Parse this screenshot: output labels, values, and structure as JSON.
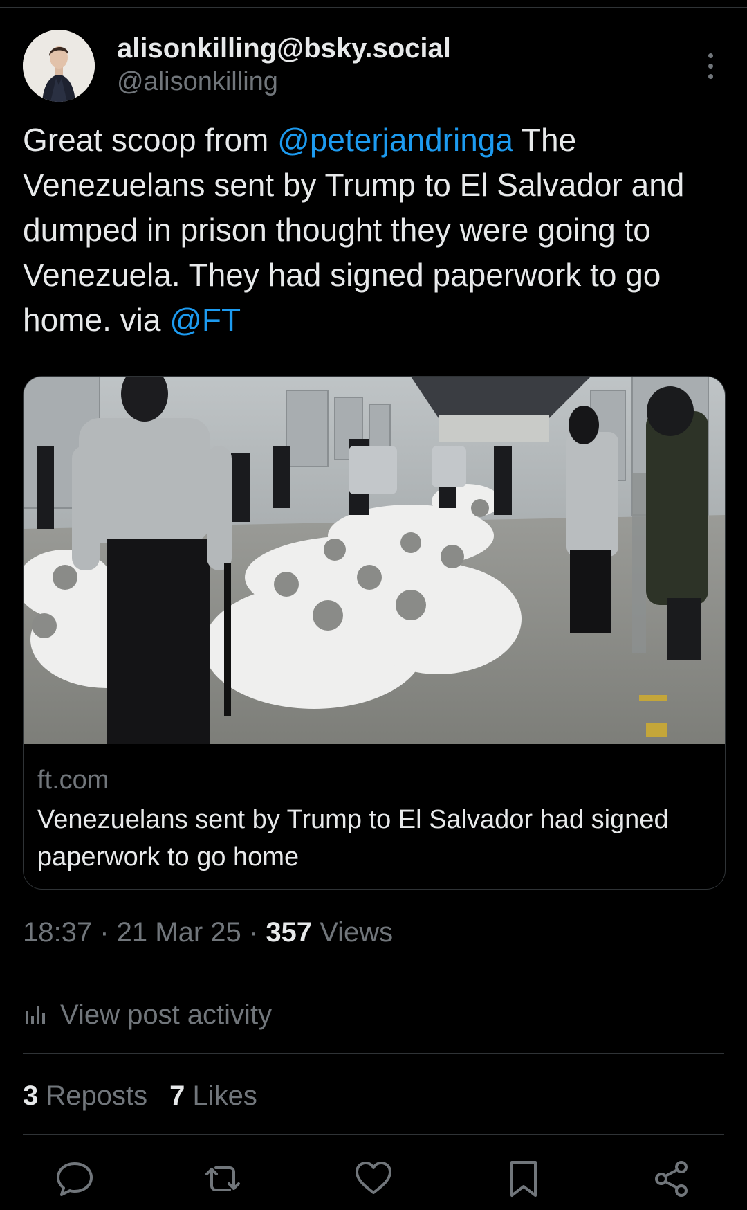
{
  "post": {
    "display_name": "alisonkilling@bsky.social",
    "handle": "@alisonkilling",
    "text": {
      "part1": "Great scoop from ",
      "mention1": "@peterjandringa",
      "part2": " The Venezuelans sent by Trump to El Salvador and dumped in prison thought they were going to Venezuela. They had signed paperwork to go home. via ",
      "mention2": "@FT"
    },
    "link_card": {
      "domain": "ft.com",
      "title": "Venezuelans sent by Trump to El Salvador had signed paperwork to go home"
    },
    "meta": {
      "time": "18:37",
      "date": "21 Mar 25",
      "views_count": "357",
      "views_label": "Views"
    },
    "activity_label": "View post activity",
    "reposts_count": "3",
    "reposts_label": "Reposts",
    "likes_count": "7",
    "likes_label": "Likes"
  },
  "icons": {
    "more": "more-vertical-icon",
    "activity": "bar-chart-icon",
    "reply": "reply-bubble-icon",
    "repost": "repost-icon",
    "like": "heart-icon",
    "bookmark": "bookmark-icon",
    "share": "share-icon"
  },
  "colors": {
    "background": "#000000",
    "text": "#e7e9ea",
    "muted": "#71767b",
    "link": "#1d9bf0",
    "divider": "#2f3336"
  }
}
